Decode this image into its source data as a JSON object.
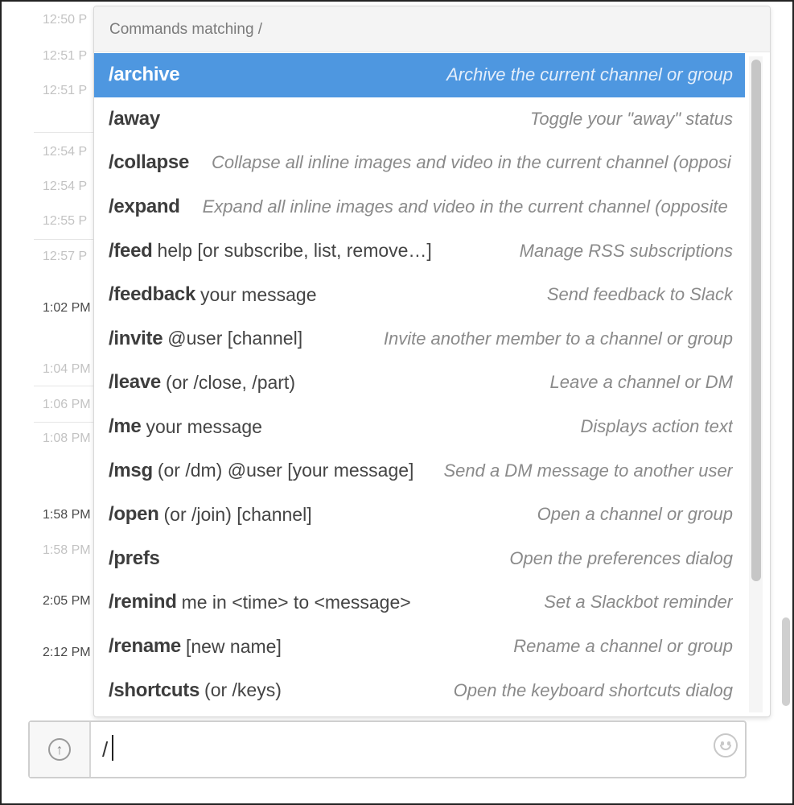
{
  "background": {
    "timestamps": [
      {
        "text": "12:50 P",
        "dark": false
      },
      {
        "text": "12:51 P",
        "dark": false
      },
      {
        "text": "12:51 P",
        "dark": false
      },
      {
        "text": "12:54 P",
        "dark": false
      },
      {
        "text": "12:54 P",
        "dark": false
      },
      {
        "text": "12:55 P",
        "dark": false
      },
      {
        "text": "12:57 P",
        "dark": false
      },
      {
        "text": "1:02 PM",
        "dark": true
      },
      {
        "text": "1:04 PM",
        "dark": false
      },
      {
        "text": "1:06 PM",
        "dark": false
      },
      {
        "text": "1:08 PM",
        "dark": false
      },
      {
        "text": "1:58 PM",
        "dark": true
      },
      {
        "text": "1:58 PM",
        "dark": false
      },
      {
        "text": "2:05 PM",
        "dark": true
      },
      {
        "text": "2:12 PM",
        "dark": true
      }
    ]
  },
  "popup": {
    "header": "Commands matching /",
    "selected_index": 0,
    "commands": [
      {
        "name": "/archive",
        "args": "",
        "desc": "Archive the current channel or group"
      },
      {
        "name": "/away",
        "args": "",
        "desc": "Toggle your \"away\" status"
      },
      {
        "name": "/collapse",
        "args": "",
        "desc": "Collapse all inline images and video in the current channel (opposi"
      },
      {
        "name": "/expand",
        "args": "",
        "desc": "Expand all inline images and video in the current channel (opposite"
      },
      {
        "name": "/feed",
        "args": "help [or subscribe, list, remove…]",
        "desc": "Manage RSS subscriptions"
      },
      {
        "name": "/feedback",
        "args": "your message",
        "desc": "Send feedback to Slack"
      },
      {
        "name": "/invite",
        "args": "@user [channel]",
        "desc": "Invite another member to a channel or group"
      },
      {
        "name": "/leave",
        "args": "(or /close, /part)",
        "desc": "Leave a channel or DM"
      },
      {
        "name": "/me",
        "args": "your message",
        "desc": "Displays action text"
      },
      {
        "name": "/msg",
        "args": "(or /dm) @user [your message]",
        "desc": "Send a DM message to another user"
      },
      {
        "name": "/open",
        "args": "(or /join) [channel]",
        "desc": "Open a channel or group"
      },
      {
        "name": "/prefs",
        "args": "",
        "desc": "Open the preferences dialog"
      },
      {
        "name": "/remind",
        "args": "me in <time> to <message>",
        "desc": "Set a Slackbot reminder"
      },
      {
        "name": "/rename",
        "args": "[new name]",
        "desc": "Rename a channel or group"
      },
      {
        "name": "/shortcuts",
        "args": "(or /keys)",
        "desc": "Open the keyboard shortcuts dialog"
      }
    ]
  },
  "composer": {
    "value": "/",
    "upload_icon": "arrow-up-circle-icon",
    "emoji_icon": "smiley-icon"
  },
  "colors": {
    "selected_row": "#4e97e0",
    "desc_text": "#8a8a8a"
  }
}
